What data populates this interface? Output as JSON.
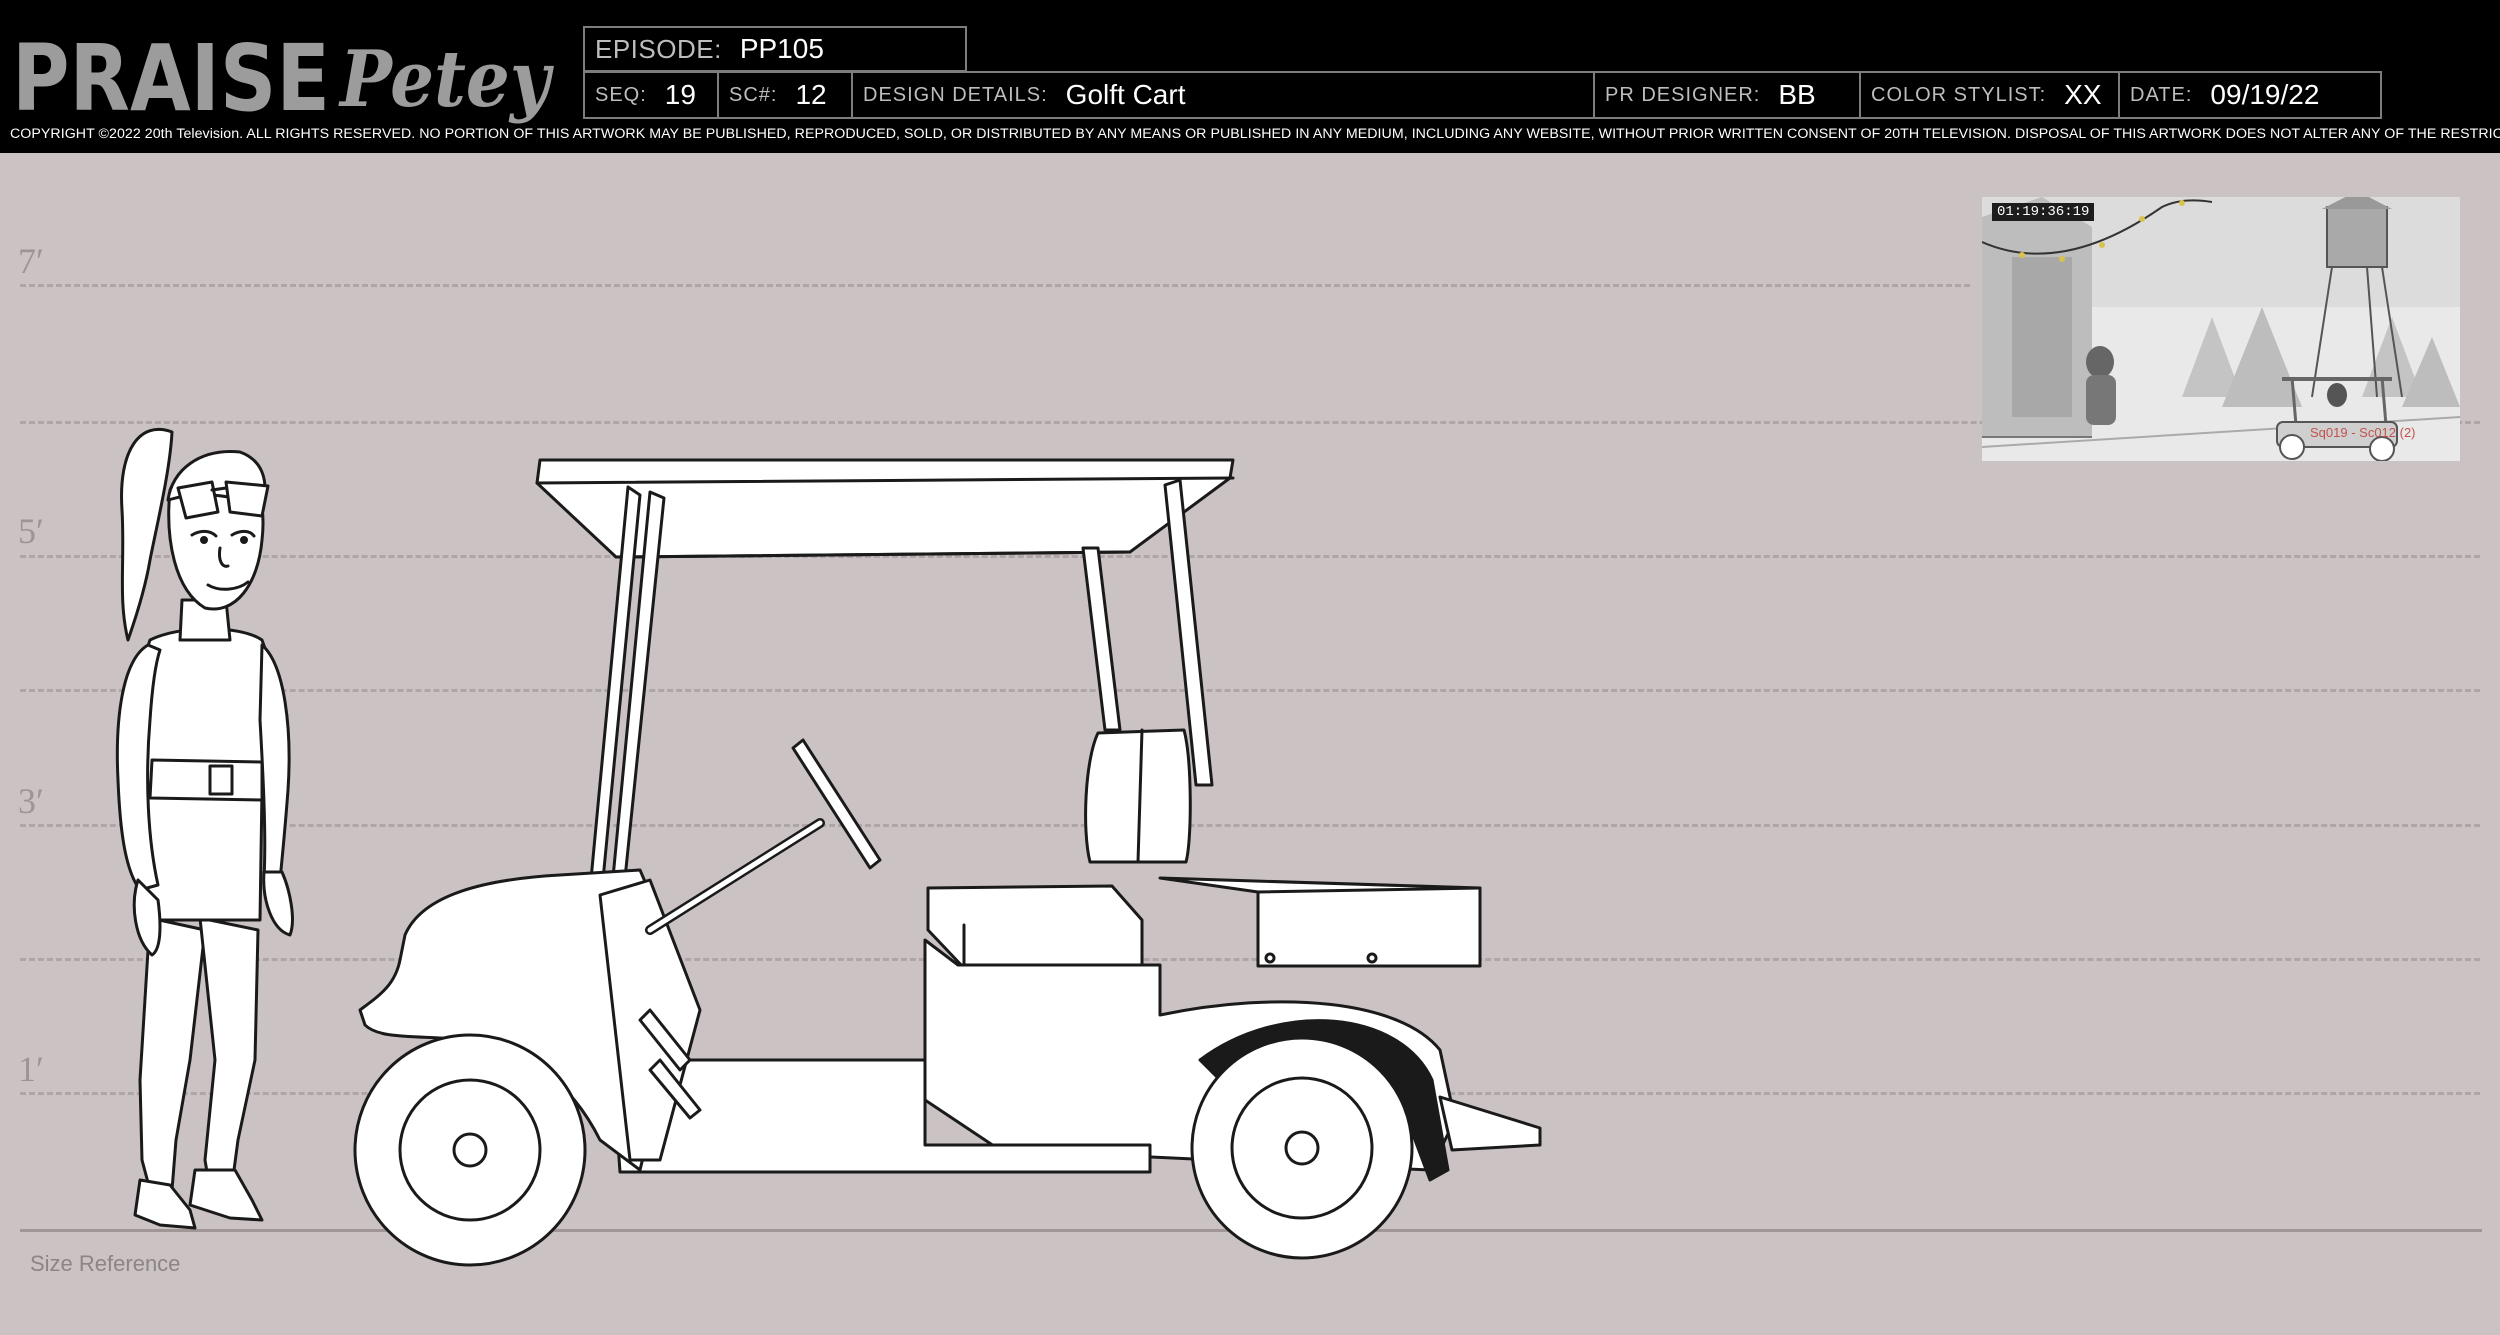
{
  "logo": {
    "word1": "PRAISE",
    "word2": "Petey"
  },
  "header": {
    "episode": {
      "label": "EPISODE:",
      "value": "PP105"
    },
    "seq": {
      "label": "SEQ:",
      "value": "19"
    },
    "sc": {
      "label": "SC#:",
      "value": "12"
    },
    "design_details": {
      "label": "DESIGN DETAILS:",
      "value": "Golft Cart"
    },
    "pr_designer": {
      "label": "PR DESIGNER:",
      "value": "BB"
    },
    "color_stylist": {
      "label": "COLOR STYLIST:",
      "value": "XX"
    },
    "date": {
      "label": "DATE:",
      "value": "09/19/22"
    }
  },
  "copyright": "COPYRIGHT ©2022 20th Television. ALL RIGHTS RESERVED. NO PORTION OF THIS ARTWORK MAY BE PUBLISHED, REPRODUCED, SOLD, OR DISTRIBUTED BY ANY MEANS OR PUBLISHED IN ANY MEDIUM, INCLUDING ANY WEBSITE, WITHOUT PRIOR WRITTEN CONSENT OF 20TH TELEVISION. DISPOSAL OF THIS ARTWORK DOES NOT ALTER ANY OF THE RESTRICTIONS SET FORTH ABOVE.",
  "height_labels": {
    "h7": "7′",
    "h5": "5′",
    "h3": "3′",
    "h1": "1′"
  },
  "size_reference": "Size Reference",
  "thumbnail": {
    "timecode": "01:19:36:19",
    "caption": "Sq019 - Sc012 (2)"
  },
  "colors": {
    "background": "#cbc3c3",
    "header": "#000000",
    "guide": "#aea6a6",
    "thumb_caption": "#c0534d"
  }
}
